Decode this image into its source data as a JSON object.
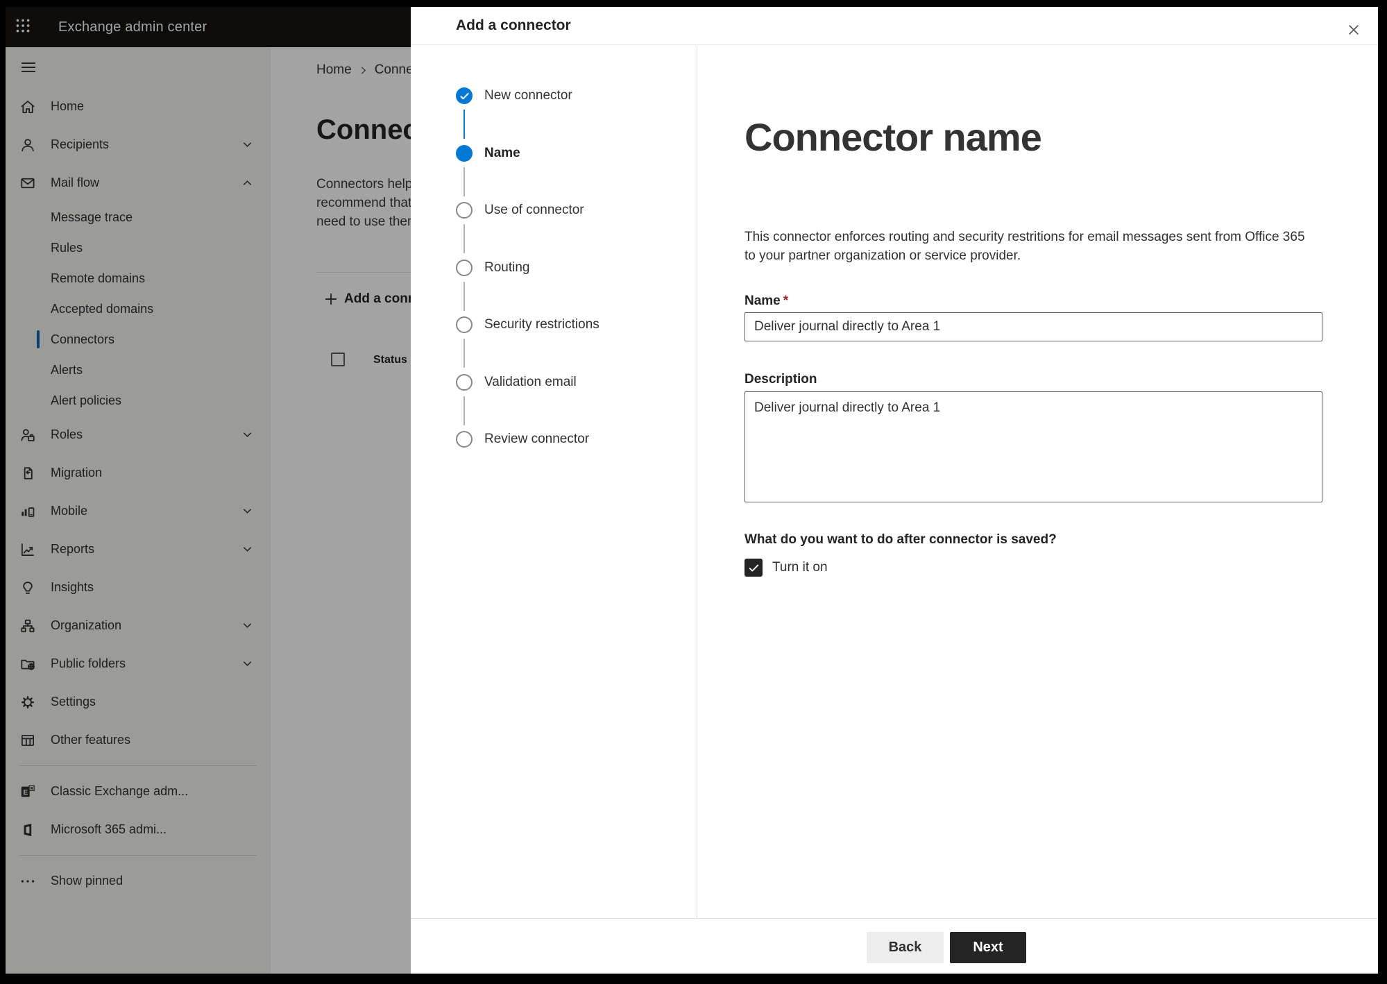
{
  "colors": {
    "accent_blue": "#0078d4",
    "primary_button_bg": "#242424",
    "back_button_bg": "#ededed",
    "required_red": "#a4262c",
    "topbar_bg": "#161514",
    "sidebar_bg": "#f3f2f1",
    "selected_indicator": "#0868b4"
  },
  "topbar": {
    "app_title": "Exchange admin center",
    "waffle_icon": "app-launcher-icon"
  },
  "sidebar": {
    "hamburger_icon": "menu-icon",
    "items": [
      {
        "label": "Home",
        "icon": "home",
        "type": "top"
      },
      {
        "label": "Recipients",
        "icon": "person",
        "type": "top",
        "chevron": "down"
      },
      {
        "label": "Mail flow",
        "icon": "mail",
        "type": "top",
        "chevron": "up"
      },
      {
        "label": "Message trace",
        "type": "sub"
      },
      {
        "label": "Rules",
        "type": "sub"
      },
      {
        "label": "Remote domains",
        "type": "sub"
      },
      {
        "label": "Accepted domains",
        "type": "sub"
      },
      {
        "label": "Connectors",
        "type": "sub",
        "selected": true
      },
      {
        "label": "Alerts",
        "type": "sub"
      },
      {
        "label": "Alert policies",
        "type": "sub"
      },
      {
        "label": "Roles",
        "icon": "roles",
        "type": "top",
        "chevron": "down"
      },
      {
        "label": "Migration",
        "icon": "migration",
        "type": "top"
      },
      {
        "label": "Mobile",
        "icon": "mobile",
        "type": "top",
        "chevron": "down"
      },
      {
        "label": "Reports",
        "icon": "reports",
        "type": "top",
        "chevron": "down"
      },
      {
        "label": "Insights",
        "icon": "insights",
        "type": "top"
      },
      {
        "label": "Organization",
        "icon": "organization",
        "type": "top",
        "chevron": "down"
      },
      {
        "label": "Public folders",
        "icon": "public-folders",
        "type": "top",
        "chevron": "down"
      },
      {
        "label": "Settings",
        "icon": "settings",
        "type": "top"
      },
      {
        "label": "Other features",
        "icon": "other-features",
        "type": "top"
      },
      {
        "type": "divider"
      },
      {
        "label": "Classic Exchange adm...",
        "icon": "exchange-classic",
        "type": "top"
      },
      {
        "label": "Microsoft 365 admi...",
        "icon": "m365",
        "type": "top"
      },
      {
        "type": "divider"
      },
      {
        "label": "Show pinned",
        "icon": "ellipsis",
        "type": "top"
      }
    ]
  },
  "page": {
    "breadcrumb": {
      "home": "Home",
      "current": "Connectors"
    },
    "title": "Connectors",
    "intro_lines": [
      "Connectors help",
      "recommend that",
      "need to use them"
    ],
    "add_button_label": "Add a connector",
    "table": {
      "columns": [
        "Status"
      ]
    }
  },
  "modal": {
    "title": "Add a connector",
    "close_icon": "close-icon",
    "steps": [
      {
        "label": "New connector",
        "state": "completed"
      },
      {
        "label": "Name",
        "state": "current"
      },
      {
        "label": "Use of connector",
        "state": "upcoming"
      },
      {
        "label": "Routing",
        "state": "upcoming"
      },
      {
        "label": "Security restrictions",
        "state": "upcoming"
      },
      {
        "label": "Validation email",
        "state": "upcoming"
      },
      {
        "label": "Review connector",
        "state": "upcoming"
      }
    ],
    "content": {
      "heading": "Connector name",
      "description_lines": [
        "This connector enforces routing and security restritions for email messages sent from Office 365",
        "to your partner organization or service provider."
      ],
      "name_label": "Name",
      "required_marker": "*",
      "name_value": "Deliver journal directly to Area 1",
      "description_label": "Description",
      "description_value": "Deliver journal directly to Area 1",
      "after_save_question": "What do you want to do after connector is saved?",
      "turn_on_label": "Turn it on",
      "turn_on_checked": true
    },
    "footer": {
      "back_label": "Back",
      "next_label": "Next"
    }
  }
}
